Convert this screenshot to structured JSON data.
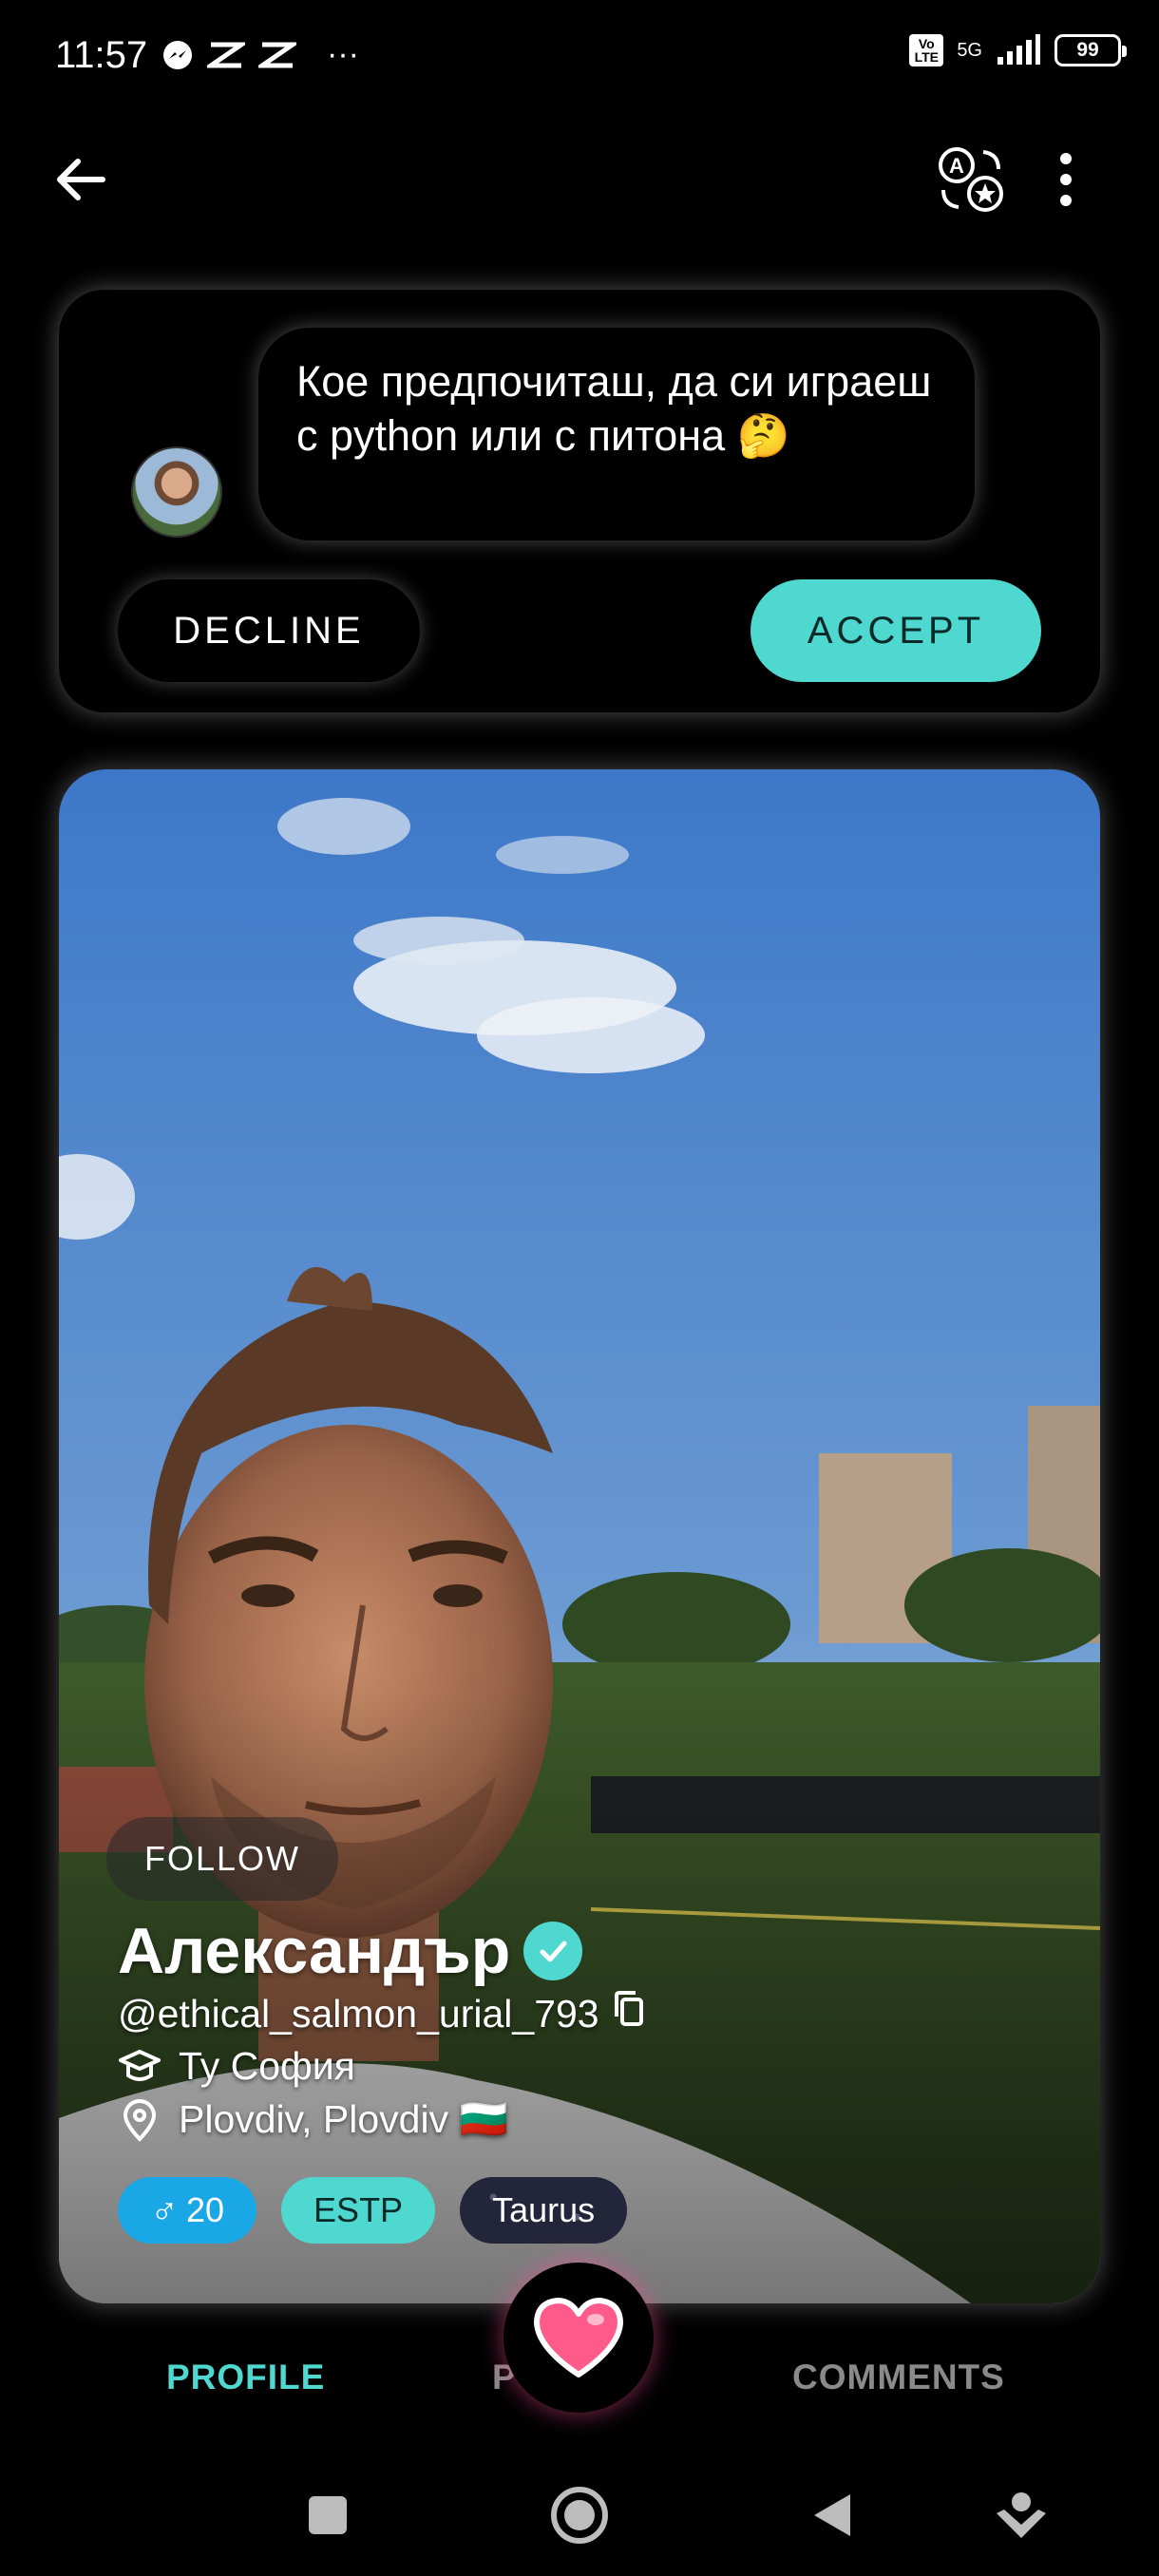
{
  "status_bar": {
    "time": "11:57",
    "signal": "5G",
    "volte": "Vo LTE",
    "battery": "99",
    "more_indicator": "···"
  },
  "app_bar": {
    "icons": [
      "back-arrow-icon",
      "translate-icon",
      "more-vertical-icon"
    ]
  },
  "request": {
    "message": "Кое предпочиташ, да си играеш с python или с питона 🤔",
    "decline_label": "DECLINE",
    "accept_label": "ACCEPT"
  },
  "profile": {
    "follow_label": "FOLLOW",
    "name": "Александър",
    "handle": "@ethical_salmon_urial_793",
    "school": "Ту София",
    "location": "Plovdiv, Plovdiv 🇧🇬",
    "age": "20",
    "gender_symbol": "♂",
    "mbti": "ESTP",
    "zodiac": "Taurus"
  },
  "tabs": {
    "profile": "PROFILE",
    "posts": "PO",
    "comments": "COMMENTS"
  },
  "colors": {
    "accent": "#4fd8cf",
    "age_tag": "#1aa7e6",
    "heart": "#ff5b8a"
  }
}
